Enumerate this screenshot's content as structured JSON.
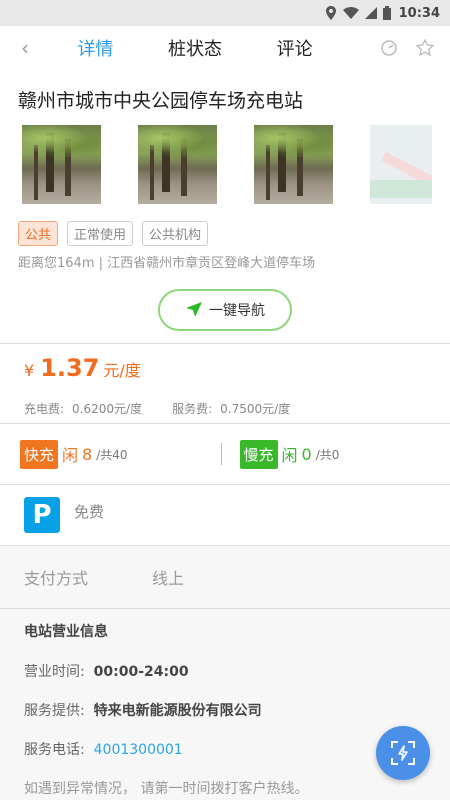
{
  "statusbar": {
    "time": "10:34",
    "icons": [
      "location-icon",
      "wifi-icon",
      "signal-icon",
      "battery-icon"
    ]
  },
  "nav": {
    "back_icon": "back-arrow-icon",
    "tabs": [
      {
        "label": "详情",
        "active": true
      },
      {
        "label": "桩状态"
      },
      {
        "label": "评论"
      }
    ],
    "actions": [
      "refresh-icon",
      "star-icon"
    ]
  },
  "station": {
    "title": "赣州市城市中央公园停车场充电站",
    "photos": [
      "photo",
      "photo",
      "photo",
      "map"
    ],
    "tags": [
      "公共",
      "正常使用",
      "公共机构"
    ],
    "address": "距离您164m | 江西省赣州市章贡区登峰大道停车场",
    "nav_button": "一键导航"
  },
  "price": {
    "currency": "¥",
    "value": "1.37",
    "unit": "元/度",
    "elec_label": "充电费:",
    "elec_value": "0.6200元/度",
    "service_label": "服务费:",
    "service_value": "0.7500元/度"
  },
  "chargers": {
    "fast": {
      "label": "快充",
      "idle_prefix": "闲",
      "idle": "8",
      "total": "/共40"
    },
    "slow": {
      "label": "慢充",
      "idle_prefix": "闲",
      "idle": "0",
      "total": "/共0"
    }
  },
  "parking": {
    "icon": "P",
    "text": "免费"
  },
  "payment": {
    "label": "支付方式",
    "value": "线上"
  },
  "info": {
    "title": "电站营业信息",
    "hours_label": "营业时间:",
    "hours": "00:00-24:00",
    "provider_label": "服务提供:",
    "provider": "特来电新能源股份有限公司",
    "phone_label": "服务电话:",
    "phone": "4001300001",
    "note": "如遇到异常情况， 请第一时间拨打客户热线。"
  },
  "colors": {
    "accent": "#2f9be8",
    "orange": "#f26a1b",
    "green": "#39b92a",
    "parking_blue": "#08a1e6",
    "fab": "#4a8fe8"
  }
}
